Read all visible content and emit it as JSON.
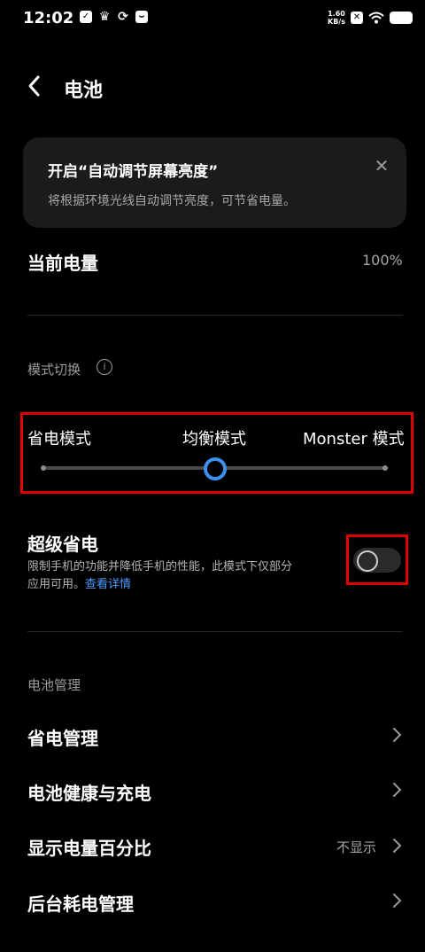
{
  "status_bar": {
    "time": "12:02",
    "net_speed_value": "1.60",
    "net_speed_unit": "KB/s"
  },
  "header": {
    "title": "电池"
  },
  "tip_card": {
    "title": "开启“自动调节屏幕亮度”",
    "description": "将根据环境光线自动调节亮度，可节省电量。"
  },
  "current_charge": {
    "label": "当前电量",
    "value": "100%"
  },
  "mode_section": {
    "header": "模式切换",
    "modes": [
      "省电模式",
      "均衡模式",
      "Monster 模式"
    ],
    "selected_index": 1
  },
  "super_saver": {
    "title": "超级省电",
    "desc_line1": "限制手机的功能并降低手机的性能，此模式下仅部分",
    "desc_line2": "应用可用。",
    "link": "查看详情",
    "enabled": false
  },
  "battery_management": {
    "header": "电池管理",
    "items": [
      {
        "label": "省电管理",
        "value": ""
      },
      {
        "label": "电池健康与充电",
        "value": ""
      },
      {
        "label": "显示电量百分比",
        "value": "不显示"
      },
      {
        "label": "后台耗电管理",
        "value": ""
      }
    ]
  },
  "colors": {
    "accent": "#3d8ff0",
    "highlight_box": "#e30000",
    "link": "#4f9cff"
  }
}
